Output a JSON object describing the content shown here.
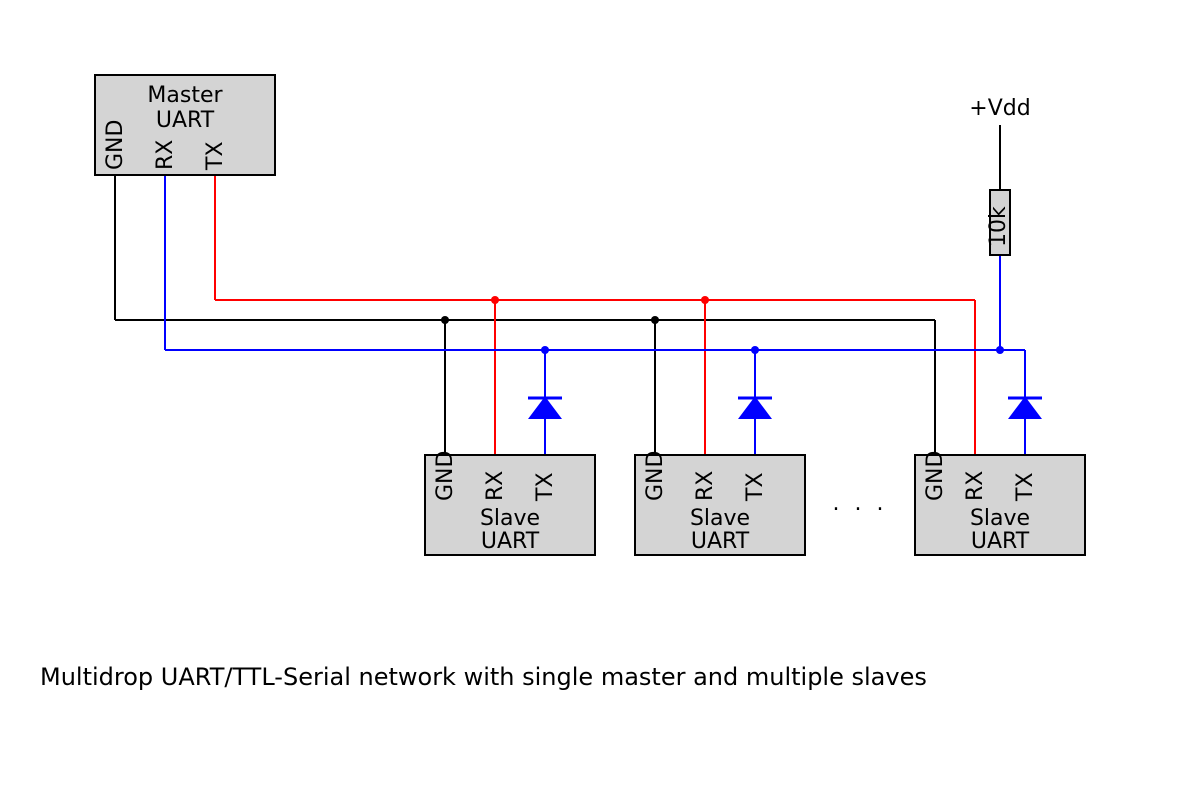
{
  "caption": "Multidrop UART/TTL-Serial network with single master and multiple slaves",
  "vdd_label": "+Vdd",
  "resistor_value": "10k",
  "ellipsis": ". . .",
  "master": {
    "title_line1": "Master",
    "title_line2": "UART",
    "pins": {
      "gnd": "GND",
      "rx": "RX",
      "tx": "TX"
    }
  },
  "slave": {
    "title_line1": "Slave",
    "title_line2": "UART",
    "pins": {
      "gnd": "GND",
      "rx": "RX",
      "tx": "TX"
    }
  }
}
